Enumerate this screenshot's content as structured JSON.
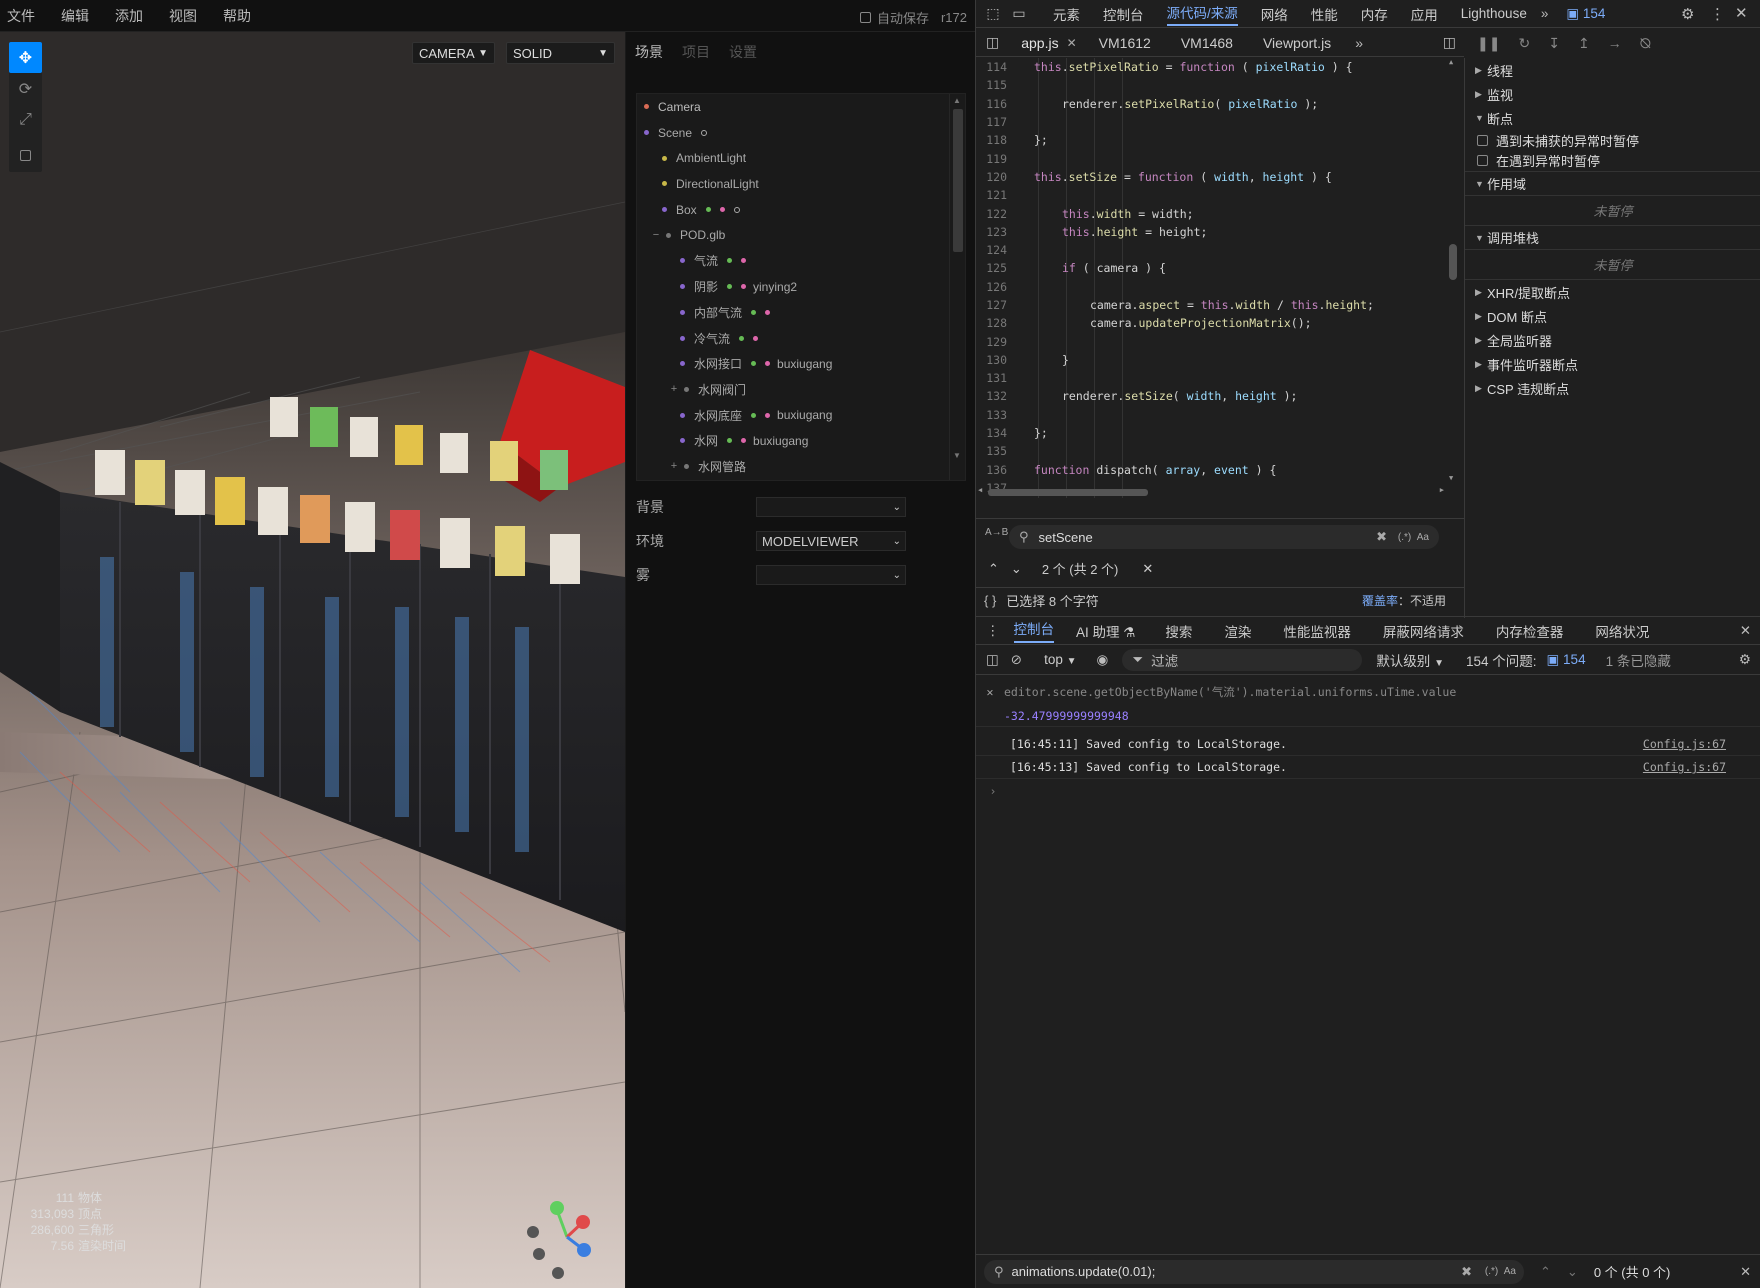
{
  "menubar": {
    "items": [
      "文件",
      "编辑",
      "添加",
      "视图",
      "帮助"
    ],
    "autosave_label": "自动保存",
    "version": "r172"
  },
  "viewport": {
    "camera_select": "CAMERA",
    "shading_select": "SOLID",
    "info": [
      {
        "value": "111",
        "label": "物体"
      },
      {
        "value": "313,093",
        "label": "顶点"
      },
      {
        "value": "286,600",
        "label": "三角形"
      },
      {
        "value": "7.56",
        "label": "渲染时间"
      }
    ]
  },
  "sidebar": {
    "tabs": [
      "场景",
      "项目",
      "设置"
    ],
    "outliner": [
      {
        "name": "Camera",
        "indent": 0,
        "dot": "#d96b55"
      },
      {
        "name": "Scene",
        "indent": 0,
        "dot": "#8866cc",
        "mdots": [
          "#999999"
        ]
      },
      {
        "name": "AmbientLight",
        "indent": 1,
        "dot": "#c8b848"
      },
      {
        "name": "DirectionalLight",
        "indent": 1,
        "dot": "#c8b848"
      },
      {
        "name": "Box",
        "indent": 1,
        "dot": "#8866cc",
        "mdots": [
          "#66bb55",
          "#dd66aa",
          "#999999"
        ]
      },
      {
        "name": "POD.glb",
        "indent": 1,
        "dot": "#777777",
        "toggle": "−"
      },
      {
        "name": "气流",
        "indent": 2,
        "dot": "#8866cc",
        "mdots": [
          "#66bb55",
          "#dd66aa"
        ]
      },
      {
        "name": "阴影",
        "indent": 2,
        "dot": "#8866cc",
        "mdots": [
          "#66bb55",
          "#dd66aa"
        ],
        "material": "yinying2"
      },
      {
        "name": "内部气流",
        "indent": 2,
        "dot": "#8866cc",
        "mdots": [
          "#66bb55",
          "#dd66aa"
        ]
      },
      {
        "name": "冷气流",
        "indent": 2,
        "dot": "#8866cc",
        "mdots": [
          "#66bb55",
          "#dd66aa"
        ]
      },
      {
        "name": "水网接口",
        "indent": 2,
        "dot": "#8866cc",
        "mdots": [
          "#66bb55",
          "#dd66aa"
        ],
        "material": "buxiugang"
      },
      {
        "name": "水网阀门",
        "indent": 2,
        "dot": "#777777",
        "toggle": "+"
      },
      {
        "name": "水网底座",
        "indent": 2,
        "dot": "#8866cc",
        "mdots": [
          "#66bb55",
          "#dd66aa"
        ],
        "material": "buxiugang"
      },
      {
        "name": "水网",
        "indent": 2,
        "dot": "#8866cc",
        "mdots": [
          "#66bb55",
          "#dd66aa"
        ],
        "material": "buxiugang"
      },
      {
        "name": "水网管路",
        "indent": 2,
        "dot": "#777777",
        "toggle": "+"
      }
    ],
    "props": {
      "background_label": "背景",
      "background_value": "",
      "environment_label": "环境",
      "environment_value": "MODELVIEWER",
      "fog_label": "雾",
      "fog_value": ""
    }
  },
  "devtools": {
    "main_tabs": [
      "元素",
      "控制台",
      "源代码/来源",
      "网络",
      "性能",
      "内存",
      "应用",
      "Lighthouse"
    ],
    "active_tab": "源代码/来源",
    "issue_count": "154",
    "file_tabs": [
      "app.js",
      "VM1612",
      "VM1468",
      "Viewport.js"
    ],
    "code_lines": [
      {
        "n": "114",
        "t": "this.setPixelRatio = function ( pixelRatio ) {",
        "indent": 2
      },
      {
        "n": "115",
        "t": "",
        "indent": 0
      },
      {
        "n": "116",
        "t": "renderer.setPixelRatio( pixelRatio );",
        "indent": 3
      },
      {
        "n": "117",
        "t": "",
        "indent": 0
      },
      {
        "n": "118",
        "t": "};",
        "indent": 2
      },
      {
        "n": "119",
        "t": "",
        "indent": 0
      },
      {
        "n": "120",
        "t": "this.setSize = function ( width, height ) {",
        "indent": 2
      },
      {
        "n": "121",
        "t": "",
        "indent": 0
      },
      {
        "n": "122",
        "t": "this.width = width;",
        "indent": 3
      },
      {
        "n": "123",
        "t": "this.height = height;",
        "indent": 3
      },
      {
        "n": "124",
        "t": "",
        "indent": 0
      },
      {
        "n": "125",
        "t": "if ( camera ) {",
        "indent": 3
      },
      {
        "n": "126",
        "t": "",
        "indent": 0
      },
      {
        "n": "127",
        "t": "camera.aspect = this.width / this.height;",
        "indent": 4
      },
      {
        "n": "128",
        "t": "camera.updateProjectionMatrix();",
        "indent": 4
      },
      {
        "n": "129",
        "t": "",
        "indent": 0
      },
      {
        "n": "130",
        "t": "}",
        "indent": 3
      },
      {
        "n": "131",
        "t": "",
        "indent": 0
      },
      {
        "n": "132",
        "t": "renderer.setSize( width, height );",
        "indent": 3
      },
      {
        "n": "133",
        "t": "",
        "indent": 0
      },
      {
        "n": "134",
        "t": "};",
        "indent": 2
      },
      {
        "n": "135",
        "t": "",
        "indent": 0
      },
      {
        "n": "136",
        "t": "function dispatch( array, event ) {",
        "indent": 2
      },
      {
        "n": "137",
        "t": "",
        "indent": 0
      }
    ],
    "search_value": "setScene",
    "search_results": "2 个 (共 2 个)",
    "selection_status": "已选择 8 个字符",
    "coverage_label": "覆盖率",
    "coverage_value": "不适用",
    "breakpoint_sections": [
      {
        "label": "线程",
        "open": false
      },
      {
        "label": "监视",
        "open": false
      },
      {
        "label": "断点",
        "open": true
      }
    ],
    "bp_checkboxes": [
      "遇到未捕获的异常时暂停",
      "在遇到异常时暂停"
    ],
    "scope_label": "作用域",
    "not_paused": "未暂停",
    "callstack_label": "调用堆栈",
    "more_sections": [
      "XHR/提取断点",
      "DOM 断点",
      "全局监听器",
      "事件监听器断点",
      "CSP 违规断点"
    ],
    "drawer_tabs": [
      "控制台",
      "AI 助理",
      "搜索",
      "渲染",
      "性能监视器",
      "屏蔽网络请求",
      "内存检查器",
      "网络状况"
    ],
    "context": "top",
    "filter_placeholder": "过滤",
    "level_select": "默认级别",
    "issues_label": "154 个问题:",
    "hidden_label": "1 条已隐藏",
    "console_cmd": "editor.scene.getObjectByName('气流').material.uniforms.uTime.value",
    "console_result": "-32.47999999999948",
    "logs": [
      {
        "text": "[16:45:11] Saved config to LocalStorage.",
        "src": "Config.js:67"
      },
      {
        "text": "[16:45:13] Saved config to LocalStorage.",
        "src": "Config.js:67"
      }
    ],
    "bottom_search_value": "animations.update(0.01);",
    "bottom_search_results": "0 个 (共 0 个)"
  }
}
